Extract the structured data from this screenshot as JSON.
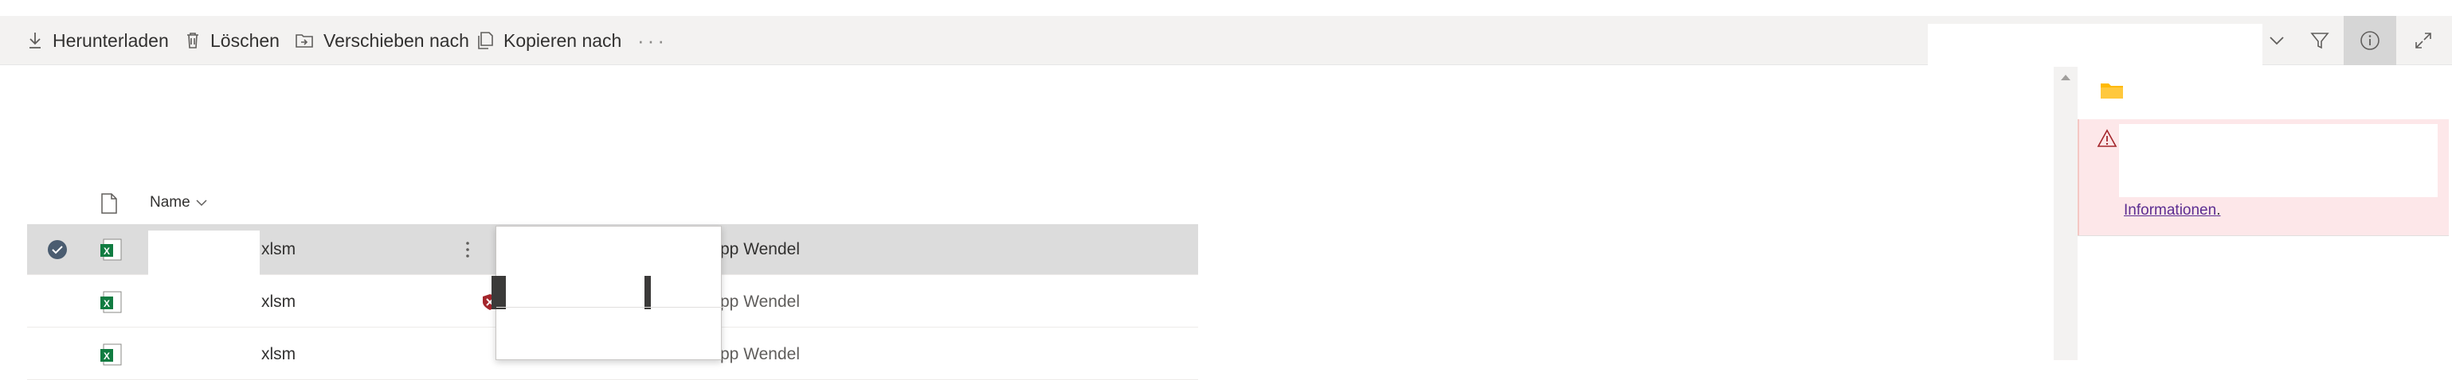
{
  "toolbar": {
    "download": "Herunterladen",
    "delete": "Löschen",
    "move": "Verschieben nach",
    "copy": "Kopieren nach",
    "more": "···"
  },
  "list": {
    "name_header": "Name",
    "rows": [
      {
        "ext": "xlsm",
        "author": "ilipp Wendel",
        "selected": true
      },
      {
        "ext": "xlsm",
        "author": "ilipp Wendel",
        "selected": false
      },
      {
        "ext": "xlsm",
        "author": "ilipp Wendel",
        "selected": false
      }
    ]
  },
  "details": {
    "error_link": "Informationen",
    "error_link_suffix": "."
  },
  "colors": {
    "excel_green": "#107c41",
    "folder_yellow": "#ffb900",
    "error_bg": "#fde7e9",
    "error_icon": "#a4262c",
    "check_circle": "#4a5c70"
  }
}
